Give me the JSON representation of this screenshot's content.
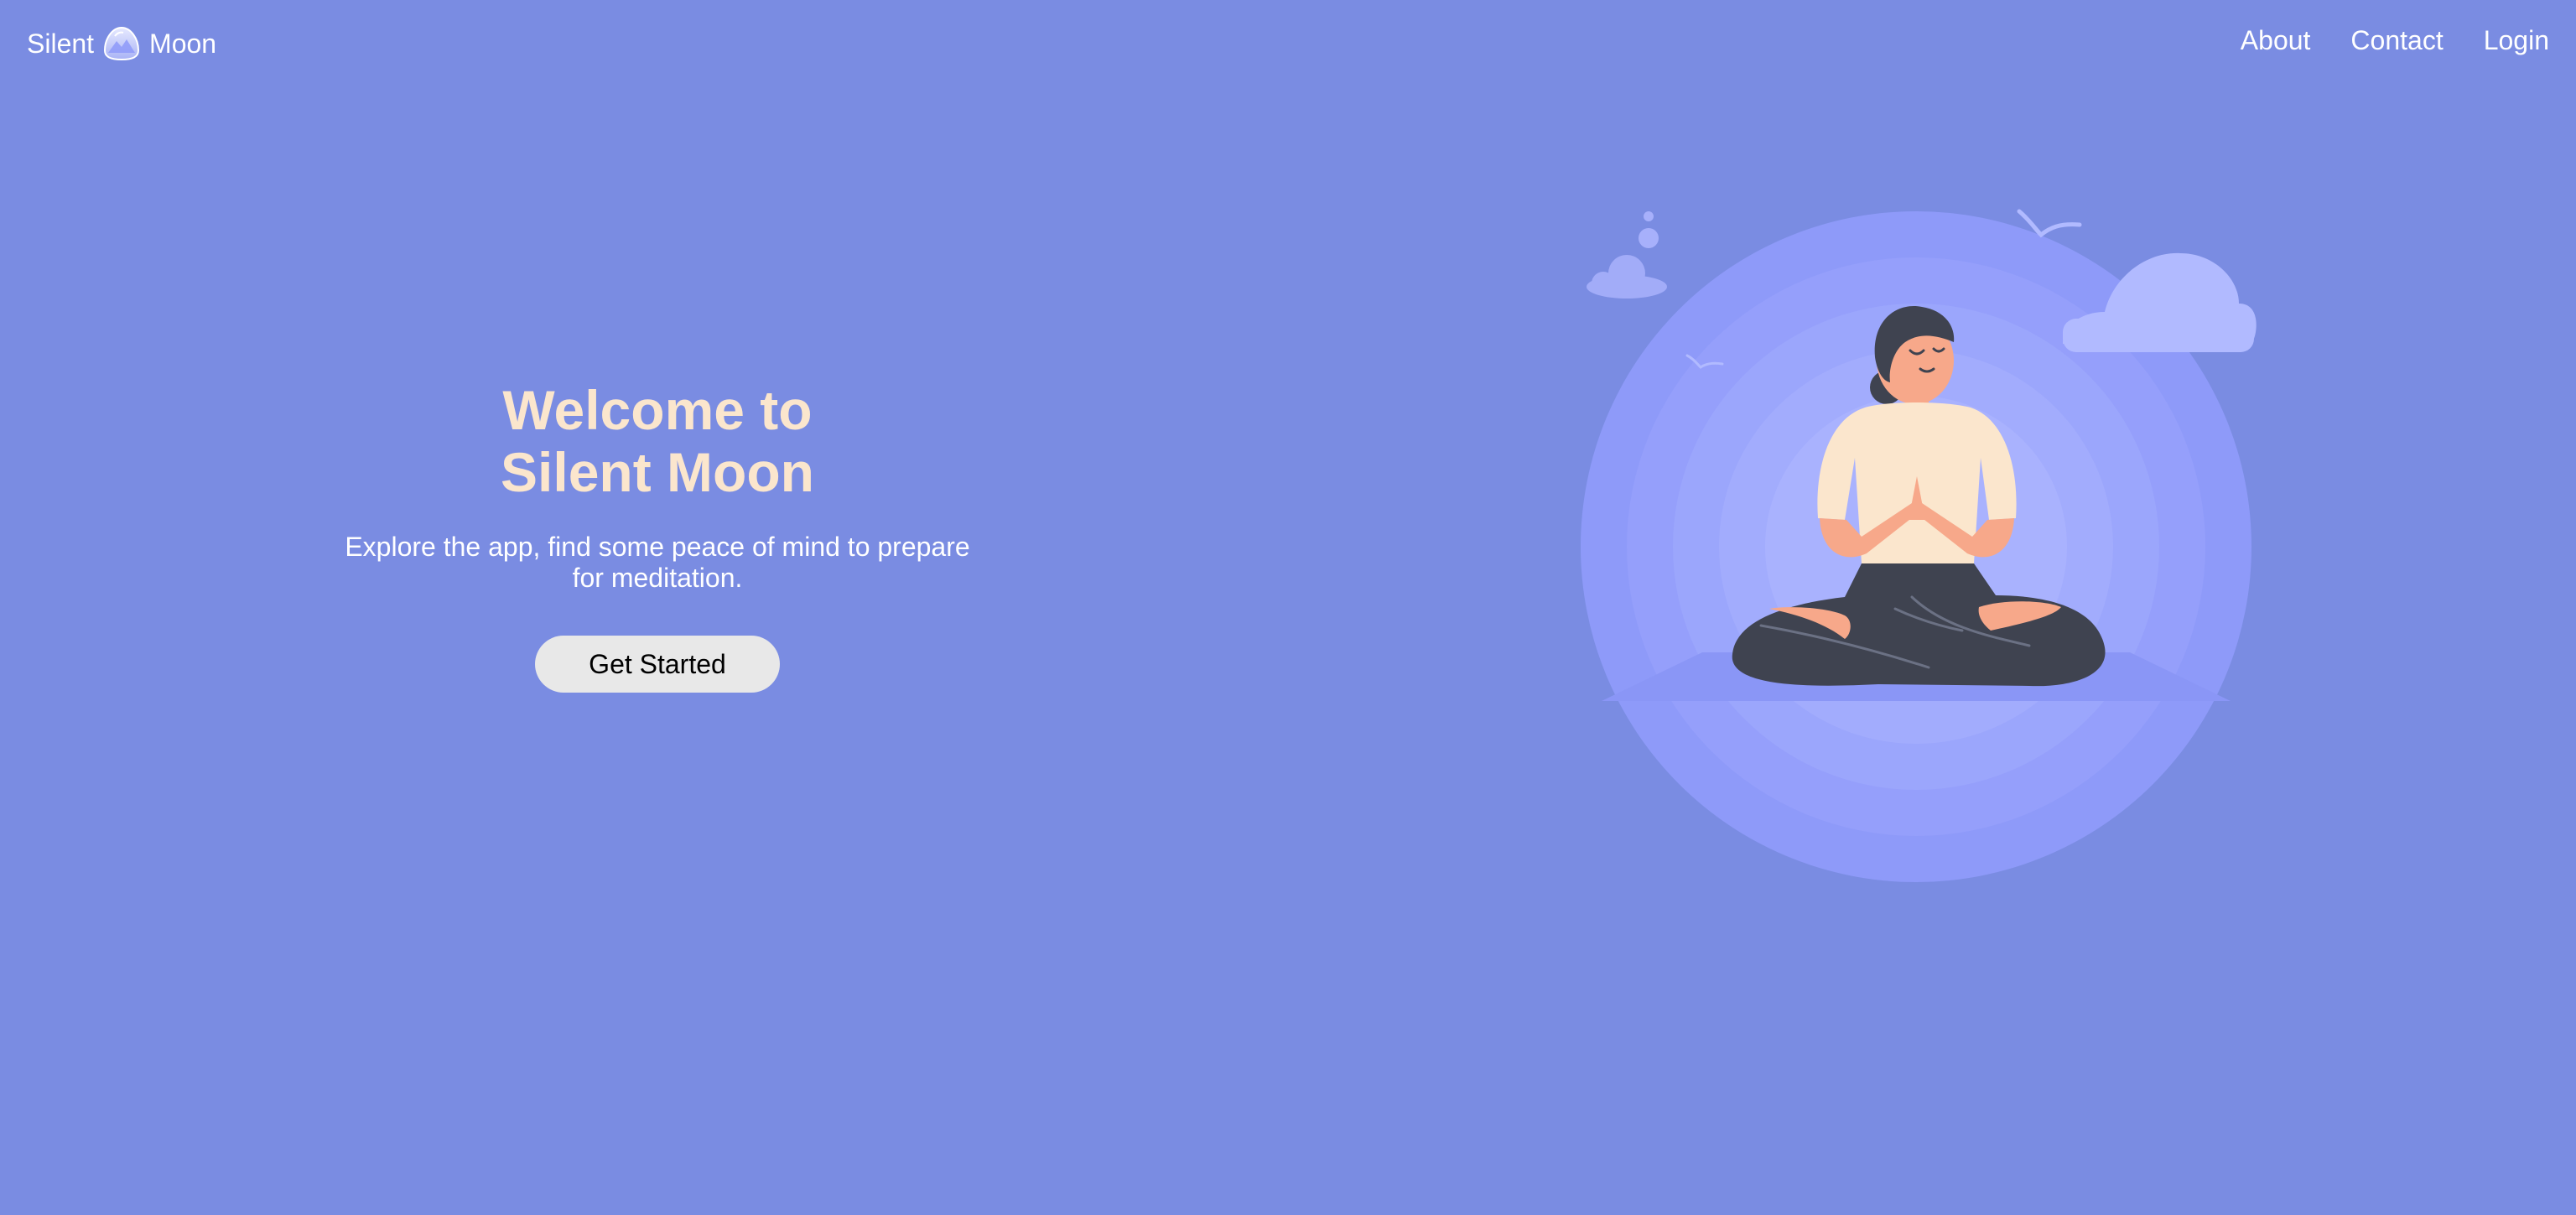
{
  "header": {
    "brand_left": "Silent",
    "brand_right": "Moon",
    "logo_icon": "moon-mountain-icon",
    "nav": [
      {
        "label": "About"
      },
      {
        "label": "Contact"
      },
      {
        "label": "Login"
      }
    ]
  },
  "hero": {
    "title_line1": "Welcome to",
    "title_line2": "Silent Moon",
    "subtitle": "Explore the app, find some peace of mind to prepare for meditation.",
    "cta_label": "Get Started",
    "illustration_icon": "meditating-woman-illustration"
  },
  "colors": {
    "background": "#7a8ce2",
    "title": "#fbe6cd",
    "button_bg": "#e8e8e8",
    "circle": "#8e9af9"
  }
}
